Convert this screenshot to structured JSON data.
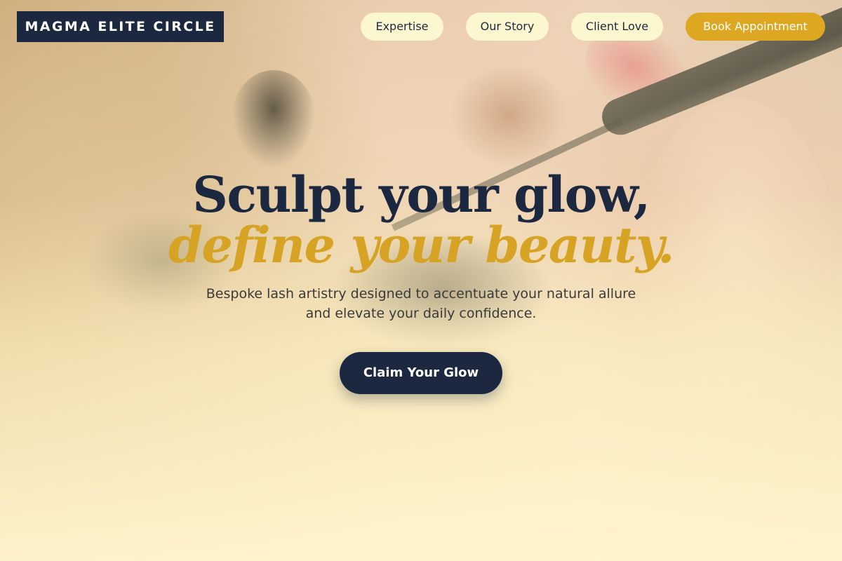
{
  "brand": {
    "logo_text": "MAGMA ELITE CIRCLE"
  },
  "nav": {
    "items": [
      {
        "label": "Expertise"
      },
      {
        "label": "Our Story"
      },
      {
        "label": "Client Love"
      }
    ],
    "cta_label": "Book Appointment"
  },
  "hero": {
    "headline": "Sculpt your glow,",
    "headline_accent": "define your beauty.",
    "subtext_line1": "Bespoke lash artistry designed to accentuate your natural allure",
    "subtext_line2": "and elevate your daily confidence.",
    "cta_label": "Claim Your Glow"
  },
  "colors": {
    "navy": "#1c2840",
    "gold": "#d7a324",
    "pill": "#fdf7cf"
  }
}
